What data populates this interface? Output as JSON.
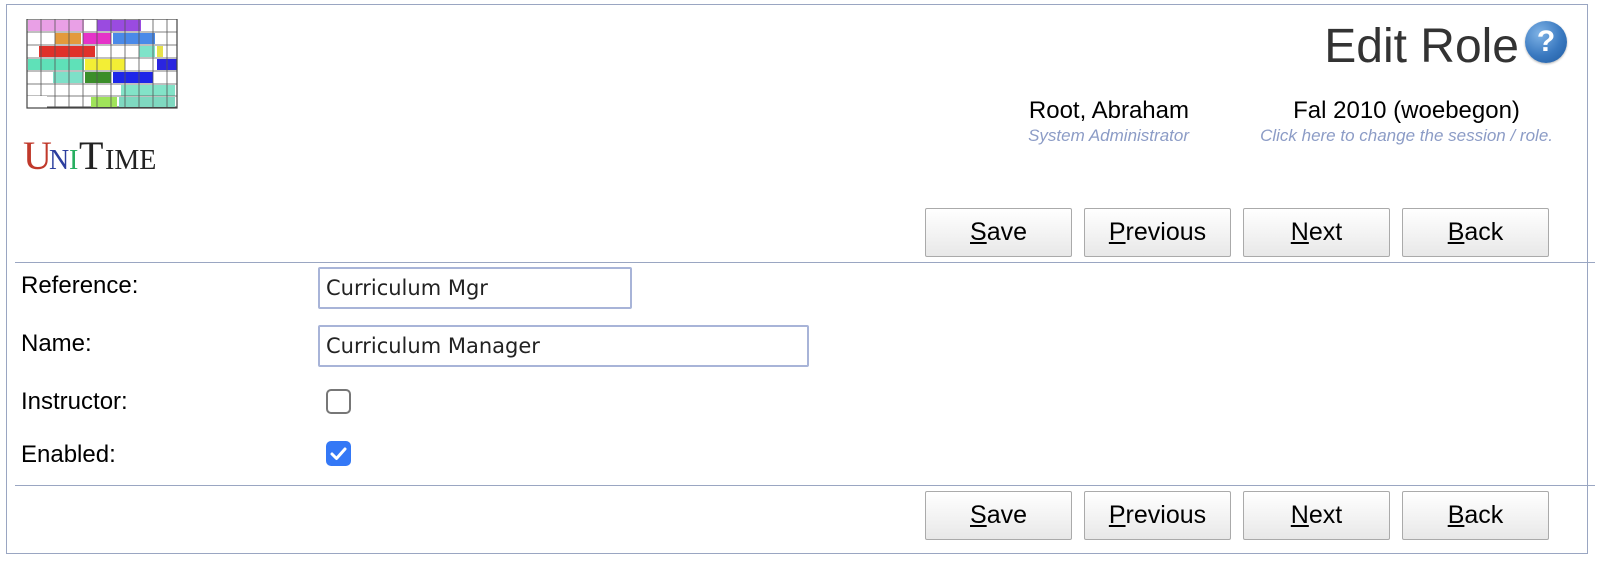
{
  "app": {
    "logo_text": "UniTime",
    "page_title": "Edit Role",
    "help_icon": "help-question-icon"
  },
  "header": {
    "user": {
      "name": "Root, Abraham",
      "role": "System Administrator"
    },
    "session": {
      "name": "Fal 2010 (woebegon)",
      "hint": "Click here to change the session / role."
    }
  },
  "buttons": {
    "save": {
      "accesskey": "S",
      "rest": "ave"
    },
    "previous": {
      "accesskey": "P",
      "rest": "revious"
    },
    "next": {
      "accesskey": "N",
      "rest": "ext"
    },
    "back": {
      "accesskey": "B",
      "rest": "ack"
    }
  },
  "form": {
    "reference": {
      "label": "Reference:",
      "value": "Curriculum Mgr"
    },
    "name": {
      "label": "Name:",
      "value": "Curriculum Manager"
    },
    "instructor": {
      "label": "Instructor:",
      "checked": false
    },
    "enabled": {
      "label": "Enabled:",
      "checked": true
    }
  },
  "colors": {
    "border": "#9aa6c2",
    "hint_text": "#8c9cc6",
    "checkbox_checked": "#3478f6",
    "logo_u": "#c0392b",
    "logo_n": "#2c3e9e",
    "logo_i": "#27ae60"
  }
}
